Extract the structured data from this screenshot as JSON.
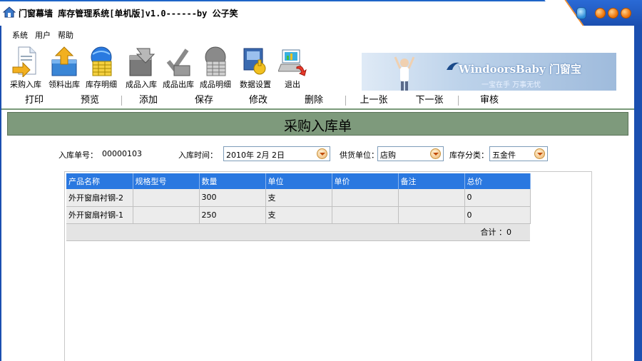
{
  "window": {
    "title": "门窗幕墙 库存管理系统[单机版]v1.0------by 公子笑"
  },
  "menu": [
    "系统",
    "用户",
    "帮助"
  ],
  "toolbar": {
    "items": [
      {
        "label": "采购入库",
        "icon": "purchase-inbound-icon"
      },
      {
        "label": "领料出库",
        "icon": "material-outbound-icon"
      },
      {
        "label": "库存明细",
        "icon": "stock-detail-icon"
      },
      {
        "label": "成品入库",
        "icon": "product-inbound-icon"
      },
      {
        "label": "成品出库",
        "icon": "product-outbound-icon"
      },
      {
        "label": "成品明细",
        "icon": "product-detail-icon"
      },
      {
        "label": "数据设置",
        "icon": "data-settings-icon"
      },
      {
        "label": "退出",
        "icon": "exit-icon"
      }
    ]
  },
  "banner": {
    "title": "WindoorsBaby 门窗宝",
    "subtitle": "一宝在手 万事无忧"
  },
  "actions": [
    "打印",
    "预览",
    "添加",
    "保存",
    "修改",
    "删除",
    "上一张",
    "下一张",
    "审核"
  ],
  "page": {
    "title": "采购入库单"
  },
  "form": {
    "receipt_no_label": "入库单号：",
    "receipt_no": "00000103",
    "date_label": "入库时间：",
    "date": "2010年 2月 2日",
    "supplier_label": "供货单位：",
    "supplier": "店购",
    "category_label": "库存分类：",
    "category": "五金件"
  },
  "grid": {
    "columns": [
      "产品名称",
      "规格型号",
      "数量",
      "单位",
      "单价",
      "备注",
      "总价"
    ],
    "rows": [
      [
        "外开窗扇衬钢-2",
        "",
        "300",
        "支",
        "",
        "",
        "0"
      ],
      [
        "外开窗扇衬钢-1",
        "",
        "250",
        "支",
        "",
        "",
        "0"
      ]
    ],
    "total_label": "合计 ：0"
  },
  "colors": {
    "titlebar_blue": "#1b4fb0",
    "grid_header_blue": "#2a78e0",
    "page_title_green": "#7e9a7c"
  }
}
